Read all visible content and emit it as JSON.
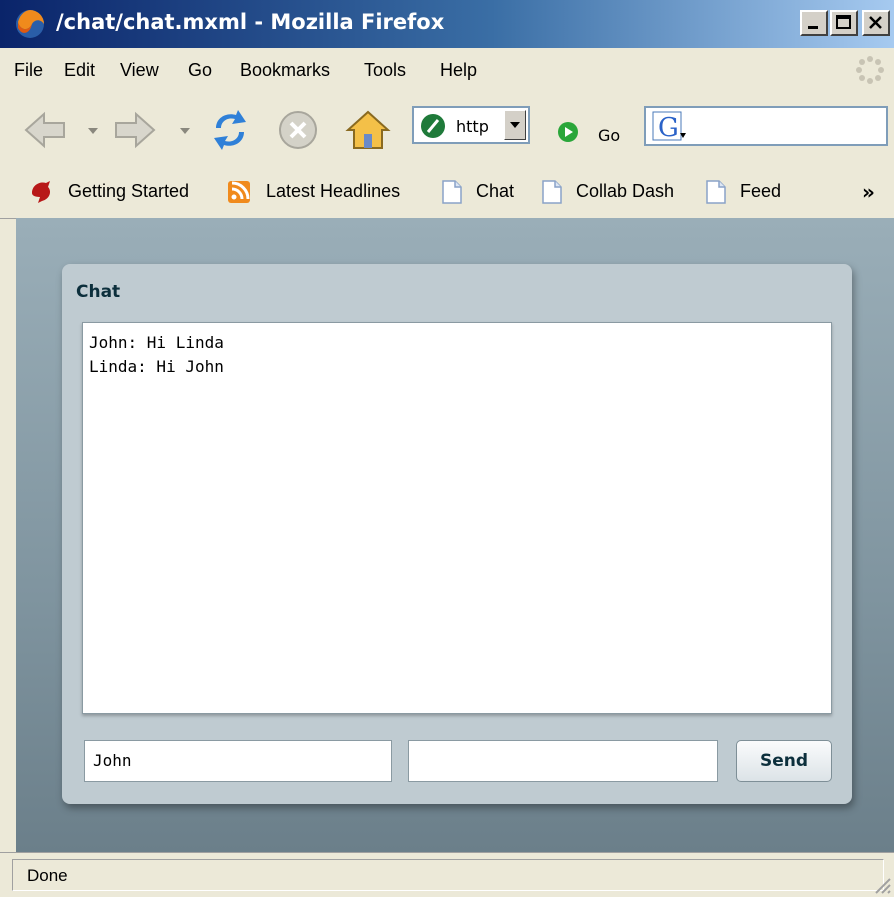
{
  "window": {
    "title": "/chat/chat.mxml - Mozilla Firefox",
    "buttons": [
      "minimize",
      "maximize",
      "close"
    ]
  },
  "menu": [
    "File",
    "Edit",
    "View",
    "Go",
    "Bookmarks",
    "Tools",
    "Help"
  ],
  "nav": {
    "url_text": "http",
    "go_label": "Go",
    "search_placeholder": ""
  },
  "bookmarks": [
    {
      "label": "Getting Started",
      "icon": "firefox-bookmark-icon"
    },
    {
      "label": "Latest Headlines",
      "icon": "rss-feed-icon"
    },
    {
      "label": "Chat",
      "icon": "page-icon"
    },
    {
      "label": "Collab Dash",
      "icon": "page-icon"
    },
    {
      "label": "Feed",
      "icon": "page-icon"
    }
  ],
  "bookmarks_more": "»",
  "chat_panel": {
    "title": "Chat",
    "messages": [
      "John: Hi Linda",
      "Linda: Hi John"
    ],
    "name_value": "John",
    "message_value": "",
    "send_label": "Send"
  },
  "status": "Done",
  "colors": {
    "titlebar": "#0a246a",
    "panel_bg": "#bfcbd1",
    "panel_title": "#0c2f3c",
    "content_bg": "#8a9ea8"
  }
}
